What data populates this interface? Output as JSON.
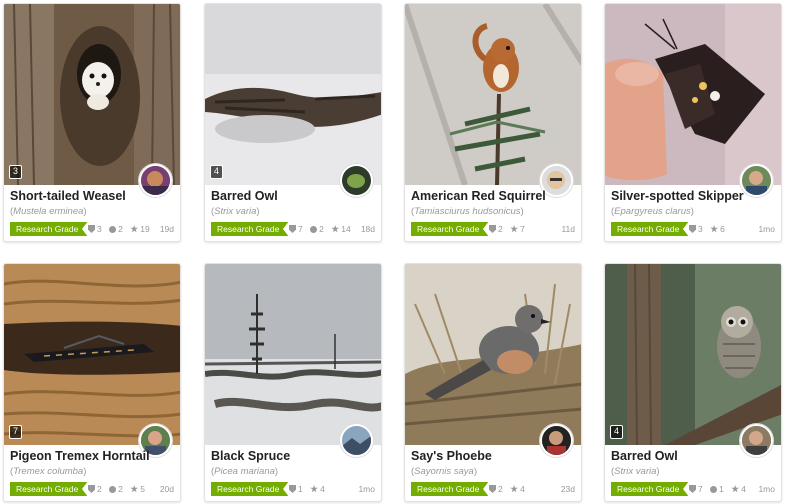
{
  "cards": [
    {
      "name": "Short-tailed Weasel",
      "sci": "Mustela erminea",
      "badge": "Research Grade",
      "photos": "3",
      "ids": "3",
      "comments": "2",
      "faves": "19",
      "age": "19d"
    },
    {
      "name": "Barred Owl",
      "sci": "Strix varia",
      "badge": "Research Grade",
      "photos": "4",
      "ids": "7",
      "comments": "2",
      "faves": "14",
      "age": "18d"
    },
    {
      "name": "American Red Squirrel",
      "sci": "Tamiasciurus hudsonicus",
      "badge": "Research Grade",
      "photos": "",
      "ids": "2",
      "comments": "",
      "faves": "7",
      "age": "11d"
    },
    {
      "name": "Silver-spotted Skipper",
      "sci": "Epargyreus clarus",
      "badge": "Research Grade",
      "photos": "",
      "ids": "3",
      "comments": "",
      "faves": "6",
      "age": "1mo"
    },
    {
      "name": "Pigeon Tremex Horntail",
      "sci": "Tremex columba",
      "badge": "Research Grade",
      "photos": "7",
      "ids": "2",
      "comments": "2",
      "faves": "5",
      "age": "20d"
    },
    {
      "name": "Black Spruce",
      "sci": "Picea mariana",
      "badge": "Research Grade",
      "photos": "",
      "ids": "1",
      "comments": "",
      "faves": "4",
      "age": "1mo"
    },
    {
      "name": "Say's Phoebe",
      "sci": "Sayornis saya",
      "badge": "Research Grade",
      "photos": "",
      "ids": "2",
      "comments": "",
      "faves": "4",
      "age": "23d"
    },
    {
      "name": "Barred Owl",
      "sci": "Strix varia",
      "badge": "Research Grade",
      "photos": "4",
      "ids": "7",
      "comments": "1",
      "faves": "4",
      "age": "1mo"
    }
  ],
  "colors": {
    "research_grade": "#74ac00",
    "meta_text": "#999999"
  },
  "icons": {
    "ids": "identification-icon",
    "comments": "comment-icon",
    "faves": "star-icon"
  }
}
